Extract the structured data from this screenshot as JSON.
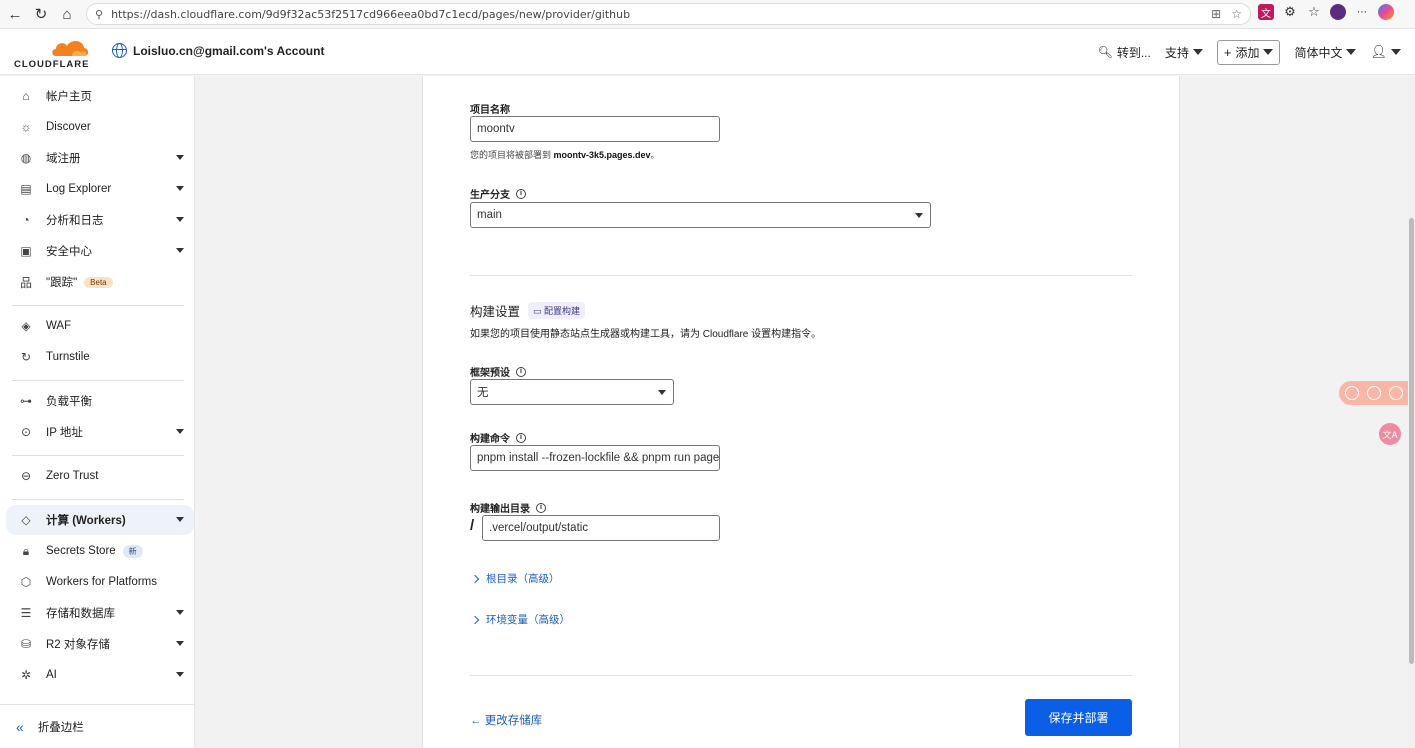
{
  "browser": {
    "url": "https://dash.cloudflare.com/9d9f32ac53f2517cd966eea0bd7c1ecd/pages/new/provider/github"
  },
  "header": {
    "logo_text": "CLOUDFLARE",
    "account": "Loisluo.cn@gmail.com's Account",
    "goto": "转到...",
    "support": "支持",
    "add": "添加",
    "language": "简体中文"
  },
  "sidebar": {
    "items": [
      {
        "label": "帐户主页",
        "icon": "home-icon"
      },
      {
        "label": "Discover",
        "icon": "lightbulb-icon"
      },
      {
        "label": "域注册",
        "icon": "globe-icon"
      },
      {
        "label": "Log Explorer",
        "icon": "document-icon"
      },
      {
        "label": "分析和日志",
        "icon": "chart-icon"
      },
      {
        "label": "安全中心",
        "icon": "shield-icon"
      },
      {
        "label": "\"跟踪\"",
        "icon": "tree-icon",
        "badge": "Beta"
      },
      {
        "label": "WAF",
        "icon": "waf-icon"
      },
      {
        "label": "Turnstile",
        "icon": "turnstile-icon"
      },
      {
        "label": "负载平衡",
        "icon": "load-balance-icon"
      },
      {
        "label": "IP 地址",
        "icon": "location-icon"
      },
      {
        "label": "Zero Trust",
        "icon": "zero-trust-icon"
      },
      {
        "label": "计算 (Workers)",
        "icon": "workers-icon"
      },
      {
        "label": "Secrets Store",
        "icon": "lock-icon",
        "badge": "新"
      },
      {
        "label": "Workers for Platforms",
        "icon": "cube-icon"
      },
      {
        "label": "存储和数据库",
        "icon": "database-icon"
      },
      {
        "label": "R2 对象存储",
        "icon": "storage-icon"
      },
      {
        "label": "AI",
        "icon": "ai-icon"
      }
    ],
    "collapse_label": "折叠边栏"
  },
  "form": {
    "project_name_label": "项目名称",
    "project_name_value": "moontv",
    "deploy_hint_prefix": "您的项目将被部署到 ",
    "deploy_hint_domain": "moontv-3k5.pages.dev",
    "deploy_hint_suffix": "。",
    "branch_label": "生产分支",
    "branch_value": "main",
    "build_settings_title": "构建设置",
    "build_settings_pill": "配置构建",
    "build_settings_desc": "如果您的项目使用静态站点生成器或构建工具，请为 Cloudflare 设置构建指令。",
    "framework_label": "框架预设",
    "framework_value": "无",
    "build_cmd_label": "构建命令",
    "build_cmd_value": "pnpm install --frozen-lockfile && pnpm run pages:build",
    "output_dir_label": "构建输出目录",
    "output_dir_value": ".vercel/output/static",
    "root_dir_label": "根目录（高级）",
    "env_vars_label": "环境变量（高级）",
    "back_label": "← 更改存储库",
    "deploy_label": "保存并部署"
  },
  "colors": {
    "primary": "#0b5fe6",
    "link": "#1a5fbd",
    "logo_orange": "#f48120"
  }
}
